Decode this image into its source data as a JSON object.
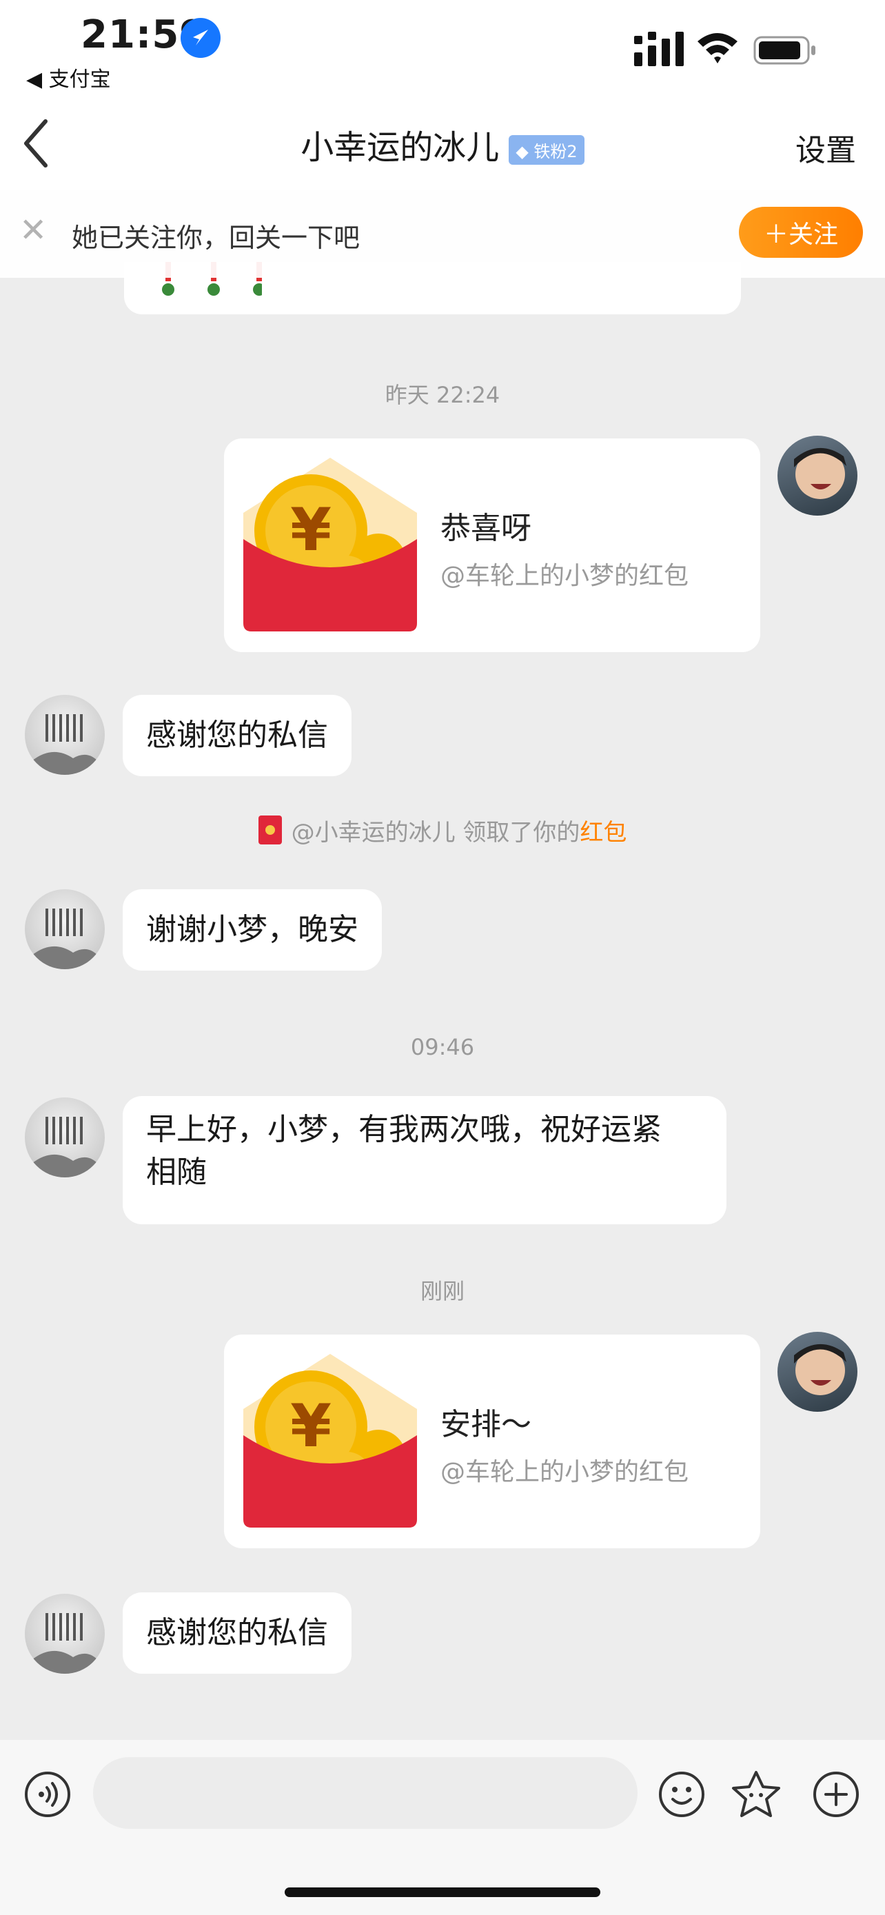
{
  "status_bar": {
    "time": "21:59",
    "back_app": "◀ 支付宝"
  },
  "nav": {
    "title": "小幸运的冰儿",
    "badge": "铁粉2",
    "settings": "设置"
  },
  "follow_banner": {
    "text": "她已关注你，回关一下吧",
    "button": "＋关注"
  },
  "messages": {
    "t1": "昨天 22:24",
    "rp1_title": "恭喜呀",
    "rp1_sub": "@车轮上的小梦的红包",
    "m1": "感谢您的私信",
    "sys_prefix": "@小幸运的冰儿 领取了你的",
    "sys_link": "红包",
    "m2": "谢谢小梦，晚安",
    "t2": "09:46",
    "m3_line1": "早上好，小梦，有我两次哦，祝好运紧",
    "m3_line2": "相随",
    "t3": "刚刚",
    "rp2_title": "安排～",
    "rp2_sub": "@车轮上的小梦的红包",
    "m4": "感谢您的私信"
  },
  "colors": {
    "accent": "#ff8200",
    "red_packet": "#e0273a",
    "coin": "#f5c020"
  },
  "icons": [
    "location-arrow-icon",
    "signal-icon",
    "wifi-icon",
    "battery-icon",
    "back-chevron-icon",
    "close-icon",
    "voice-icon",
    "emoji-icon",
    "sticker-icon",
    "plus-icon"
  ]
}
